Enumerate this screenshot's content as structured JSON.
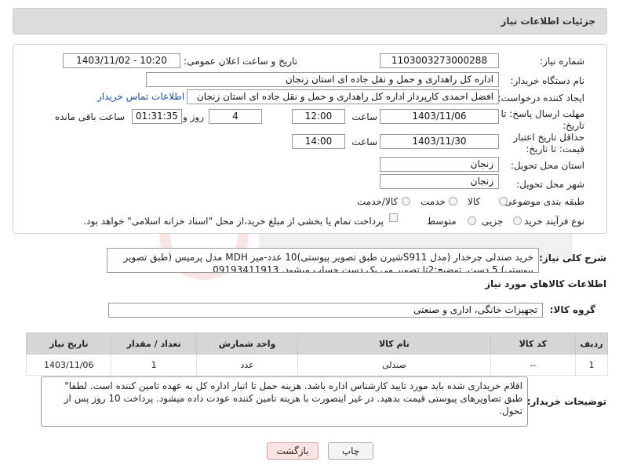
{
  "header": {
    "title": "جزئیات اطلاعات نیاز"
  },
  "form": {
    "need_number_label": "شماره نیاز:",
    "need_number": "1103003273000288",
    "announce_label": "تاریخ و ساعت اعلان عمومی:",
    "announce_value": "1403/11/02 - 10:20",
    "buyer_org_label": "نام دستگاه خریدار:",
    "buyer_org": "اداره کل راهداری و حمل و نقل جاده ای استان زنجان",
    "creator_label": "ایجاد کننده درخواست:",
    "creator": "افضل احمدی کارپرداز اداره کل راهداری و حمل و نقل جاده ای استان زنجان",
    "contact_link": "اطلاعات تماس خریدار",
    "reply_deadline_label": "مهلت ارسال پاسخ: تا تاریخ:",
    "reply_date": "1403/11/06",
    "time_label": "ساعت",
    "reply_time": "12:00",
    "days_value": "4",
    "days_label": "روز و",
    "remaining_time": "01:31:35",
    "remaining_label": "ساعت باقی مانده",
    "price_validity_label": "حداقل تاریخ اعتبار قیمت: تا تاریخ:",
    "price_date": "1403/11/30",
    "price_time": "14:00",
    "province_label": "استان محل تحویل:",
    "province": "زنجان",
    "city_label": "شهر محل تحویل:",
    "city": "زنجان",
    "category_label": "طبقه بندی موضوعی:",
    "category_goods": "کالا",
    "category_service": "خدمت",
    "category_both": "کالا/خدمت",
    "process_label": "نوع فرآیند خرید :",
    "process_partial": "جزیی",
    "process_medium": "متوسط",
    "payment_note": "پرداخت تمام یا بخشی از مبلغ خرید،از محل \"اسناد خزانه اسلامی\" خواهد بود."
  },
  "description": {
    "label": "شرح کلی نیاز:",
    "text": "خرید صندلی چرخدار (مدل S911شیرن طبق تصویر پیوستی)10 عدد-میز MDH مدل پرمیس (طبق تصویر پیوستی) 5 دست. توضیح:2تا تصویر می یک دست حساب میشود. 09193411913"
  },
  "goods_info": {
    "title": "اطلاعات کالاهای مورد نیاز",
    "group_label": "گروه کالا:",
    "group_value": "تجهیزات خانگی، اداری و صنعتی"
  },
  "table": {
    "headers": [
      "ردیف",
      "کد کالا",
      "نام کالا",
      "واحد شمارش",
      "تعداد / مقدار",
      "تاریخ نیاز"
    ],
    "rows": [
      [
        "1",
        "--",
        "صندلی",
        "عدد",
        "1",
        "1403/11/06"
      ]
    ]
  },
  "buyer_notes": {
    "label": "توضیحات خریدار:",
    "text": "اقلام خریداری شده باید مورد تایید کارشناس اداره باشد. هزینه حمل تا انبار اداره کل به عهده تامین کننده است. لطفا\" طبق تصاویرهای پیوستی قیمت بدهید. در غیر اینصورت با هزینه تامین کننده عودت داده میشود. پرداخت 10 روز پس از تحول."
  },
  "buttons": {
    "print": "چاپ",
    "back": "بازگشت"
  },
  "colors": {
    "back_button_bg": "#fbe3e3",
    "header_bg": "#dcdcdc",
    "table_header_bg": "#d6d6d6",
    "link": "#1a4fa8"
  }
}
